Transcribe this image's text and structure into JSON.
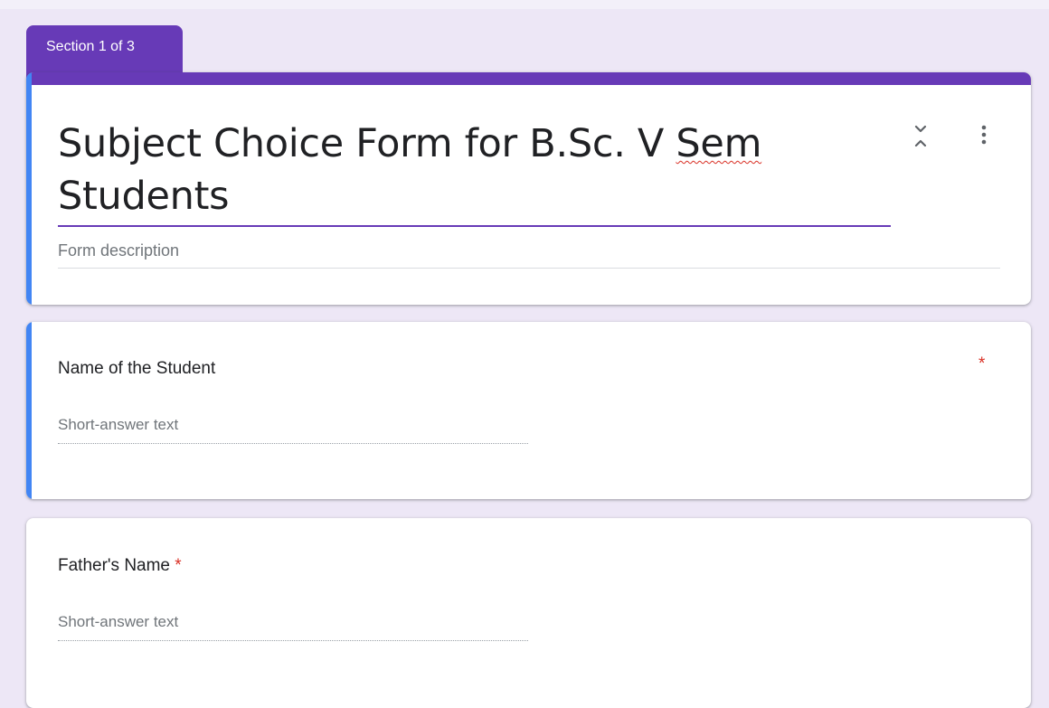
{
  "section_tab": {
    "label": "Section 1 of 3"
  },
  "form": {
    "title_line1_prefix": "Subject Choice Form for B.Sc. V ",
    "title_underlined_word": "Sem",
    "title_line2": "Students",
    "description_placeholder": "Form description"
  },
  "header_icons": {
    "collapse": "unfold-less-icon",
    "more": "more-vertical-icon"
  },
  "questions": [
    {
      "title": "Name of the Student",
      "required_marker": "*",
      "input_placeholder": "Short-answer text"
    },
    {
      "title": "Father's Name",
      "required_marker": "*",
      "input_placeholder": "Short-answer text"
    }
  ],
  "colors": {
    "accent_purple": "#673ab7",
    "active_blue": "#4285f4",
    "required_red": "#d93025",
    "background": "#ede7f6"
  }
}
